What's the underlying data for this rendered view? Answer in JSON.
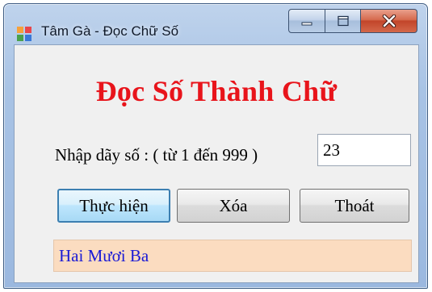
{
  "window": {
    "title": "Tâm Gà - Đọc Chữ Số"
  },
  "main": {
    "heading": "Đọc Số Thành Chữ",
    "prompt_label": "Nhập dãy số : ( từ 1 đến 999 )",
    "number_value": "23",
    "run_button": "Thực hiện",
    "clear_button": "Xóa",
    "exit_button": "Thoát",
    "result": "Hai Mươi Ba"
  },
  "colors": {
    "heading": "#e8141b",
    "result_text": "#1a1ad6",
    "result_background": "#fbdcc0",
    "window_frame": "#a8c3e5",
    "close_button": "#c2452a"
  },
  "icons": {
    "app": "windows-form-icon",
    "minimize": "minimize-icon",
    "maximize": "maximize-icon",
    "close": "close-icon"
  }
}
